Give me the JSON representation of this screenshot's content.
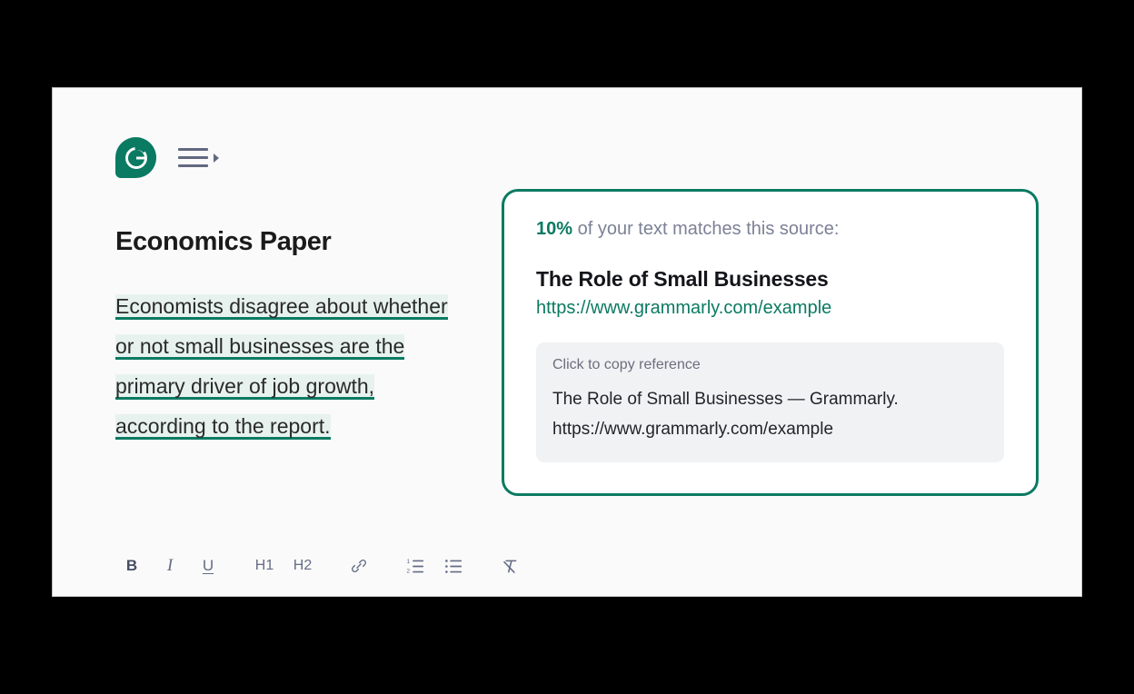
{
  "app": {
    "brand_icon": "grammarly-logo-icon",
    "menu_icon": "hamburger-menu-icon",
    "caret_icon": "caret-right-icon",
    "accent_color": "#0b7a62",
    "highlight_background": "#e7f2ef",
    "panel_background": "#fafafa"
  },
  "document": {
    "title": "Economics Paper",
    "body_text": "Economists disagree about whether or not small businesses are the primary driver of job growth, according to the report."
  },
  "toolbar": {
    "items": [
      {
        "name": "bold",
        "label": "B",
        "icon": "bold-icon"
      },
      {
        "name": "italic",
        "label": "I",
        "icon": "italic-icon"
      },
      {
        "name": "underline",
        "label": "U",
        "icon": "underline-icon"
      },
      {
        "name": "heading-1",
        "label": "H1",
        "icon": "heading-1-icon"
      },
      {
        "name": "heading-2",
        "label": "H2",
        "icon": "heading-2-icon"
      },
      {
        "name": "link",
        "label": "",
        "icon": "link-icon"
      },
      {
        "name": "numbered-list",
        "label": "",
        "icon": "ordered-list-icon"
      },
      {
        "name": "bulleted-list",
        "label": "",
        "icon": "bulleted-list-icon"
      },
      {
        "name": "clear-formatting",
        "label": "",
        "icon": "clear-formatting-icon"
      }
    ]
  },
  "source_card": {
    "match_percent": "10%",
    "match_summary_suffix": " of your text matches this source:",
    "source_title": "The Role of Small Businesses",
    "source_url": "https://www.grammarly.com/example",
    "reference": {
      "hint": "Click to copy reference",
      "text": "The Role of Small Businesses — Grammarly. https://www.grammarly.com/example"
    }
  }
}
